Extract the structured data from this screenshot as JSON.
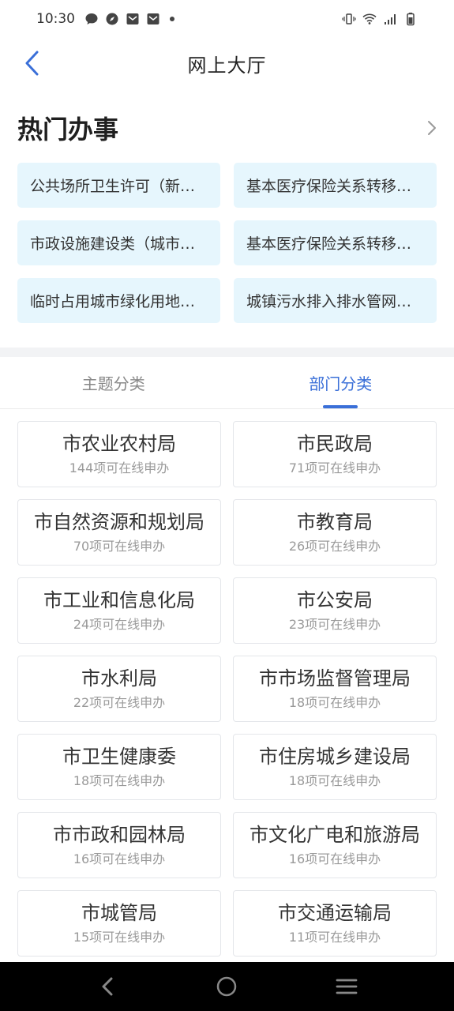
{
  "status_bar": {
    "time": "10:30"
  },
  "header": {
    "title": "网上大厅"
  },
  "hot": {
    "title": "热门办事",
    "items": [
      {
        "label": "公共场所卫生许可（新…"
      },
      {
        "label": "基本医疗保险关系转移…"
      },
      {
        "label": "市政设施建设类（城市…"
      },
      {
        "label": "基本医疗保险关系转移…"
      },
      {
        "label": "临时占用城市绿化用地…"
      },
      {
        "label": "城镇污水排入排水管网…"
      }
    ]
  },
  "tabs": [
    {
      "label": "主题分类",
      "active": false
    },
    {
      "label": "部门分类",
      "active": true
    }
  ],
  "departments": [
    {
      "name": "市农业农村局",
      "count": "144项可在线申办"
    },
    {
      "name": "市民政局",
      "count": "71项可在线申办"
    },
    {
      "name": "市自然资源和规划局",
      "count": "70项可在线申办"
    },
    {
      "name": "市教育局",
      "count": "26项可在线申办"
    },
    {
      "name": "市工业和信息化局",
      "count": "24项可在线申办"
    },
    {
      "name": "市公安局",
      "count": "23项可在线申办"
    },
    {
      "name": "市水利局",
      "count": "22项可在线申办"
    },
    {
      "name": "市市场监督管理局",
      "count": "18项可在线申办"
    },
    {
      "name": "市卫生健康委",
      "count": "18项可在线申办"
    },
    {
      "name": "市住房城乡建设局",
      "count": "18项可在线申办"
    },
    {
      "name": "市市政和园林局",
      "count": "16项可在线申办"
    },
    {
      "name": "市文化广电和旅游局",
      "count": "16项可在线申办"
    },
    {
      "name": "市城管局",
      "count": "15项可在线申办"
    },
    {
      "name": "市交通运输局",
      "count": "11项可在线申办"
    }
  ],
  "colors": {
    "accent": "#3a6fd8",
    "hot_item_bg": "#e6f6fd"
  }
}
